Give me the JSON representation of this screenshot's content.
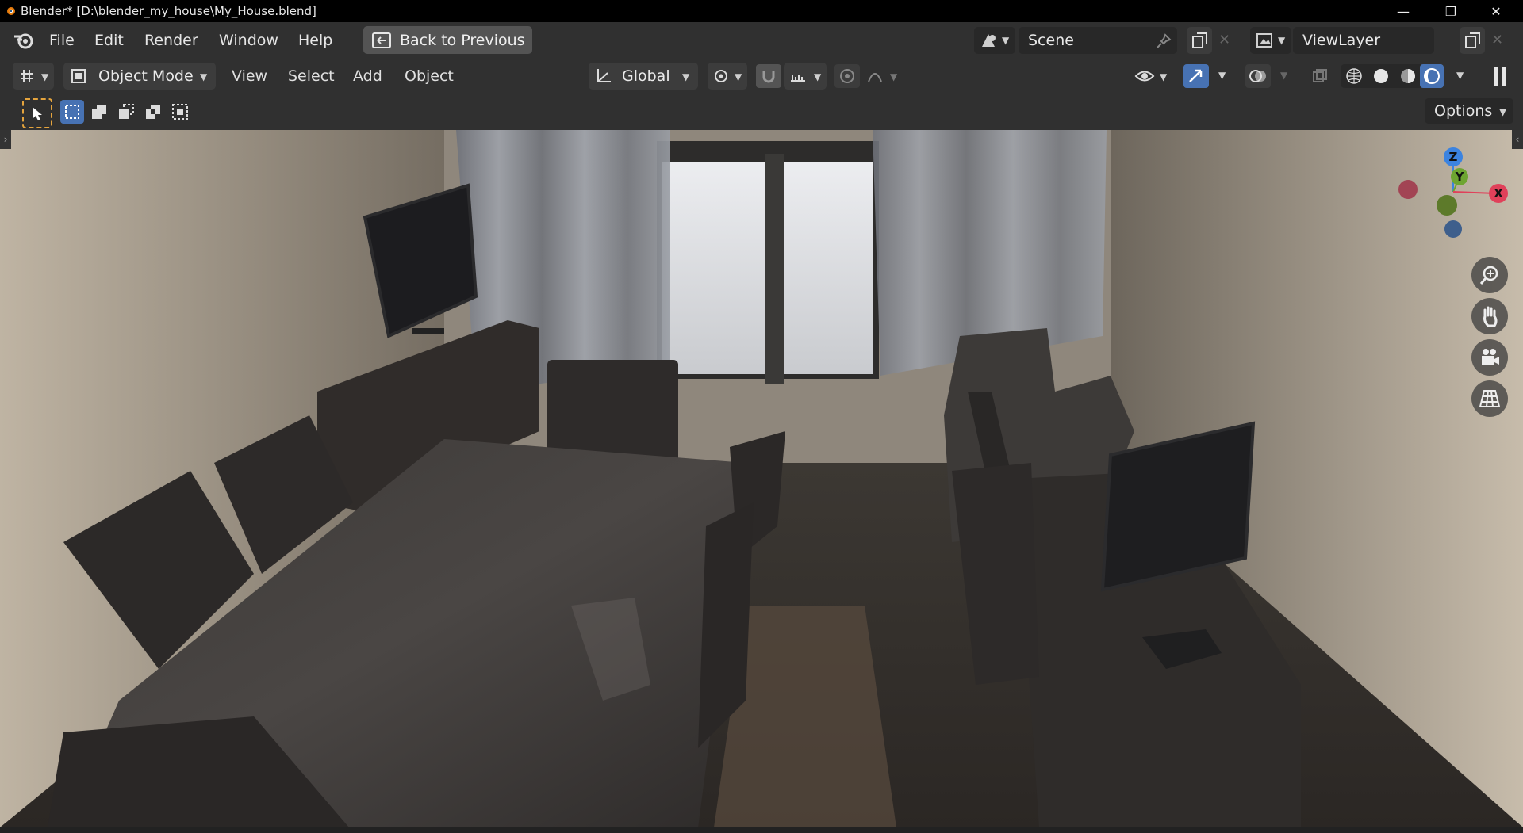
{
  "window": {
    "title": "Blender* [D:\\blender_my_house\\My_House.blend]",
    "controls": [
      "minimize-icon",
      "restore-icon",
      "close-icon"
    ]
  },
  "topbar": {
    "menus": [
      "File",
      "Edit",
      "Render",
      "Window",
      "Help"
    ],
    "back_button": "Back to Previous",
    "scene": {
      "label": "Scene"
    },
    "view_layer": {
      "label": "ViewLayer"
    }
  },
  "viewport_header": {
    "mode": "Object Mode",
    "menus": [
      "View",
      "Select",
      "Add",
      "Object"
    ],
    "transform_orientation": "Global",
    "shading_mode_active": "rendered"
  },
  "tool_settings": {
    "options_label": "Options"
  },
  "gizmo": {
    "axes": {
      "z": "Z",
      "y": "Y",
      "x": "X"
    },
    "colors": {
      "x": "#e0415a",
      "y": "#6ea531",
      "z": "#3b83e0"
    }
  },
  "nav_tools": [
    "zoom-icon",
    "hand-pan-icon",
    "camera-view-icon",
    "ortho-grid-icon"
  ],
  "colors": {
    "accent": "#4772b3",
    "select_active": "#e5a43d"
  }
}
